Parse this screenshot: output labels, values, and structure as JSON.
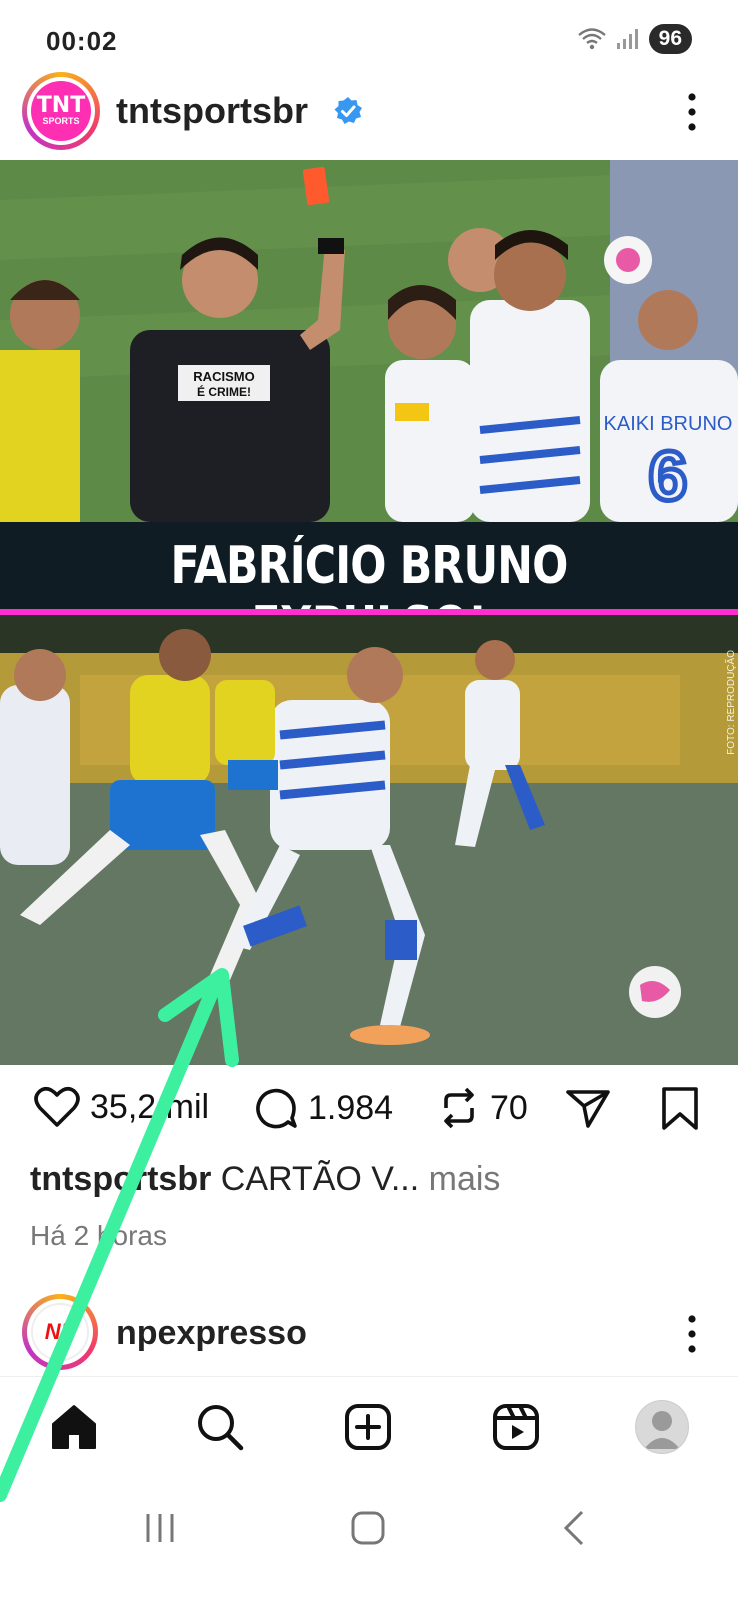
{
  "status_bar": {
    "time": "00:02",
    "battery": "96",
    "icons": [
      "wifi-icon",
      "signal-icon"
    ]
  },
  "post": {
    "username": "tntsportsbr",
    "avatar_line1": "TNT",
    "avatar_line2": "SPORTS",
    "verified_icon": "verified-badge-icon",
    "more_icon": "more-vertical-icon",
    "image": {
      "headline": "FABRÍCIO BRUNO EXPULSO!",
      "credit": "FOTO: REPRODUÇÃO",
      "shirt_text": "RACISMO\nÉ CRIME!"
    },
    "actions": {
      "likes": "35,2 mil",
      "comments": "1.984",
      "reposts": "70"
    },
    "caption_user": "tntsportsbr",
    "caption_text": "CARTÃO V...",
    "caption_more": "mais",
    "time_ago": "Há 2 horas"
  },
  "next_post": {
    "username": "npexpresso",
    "avatar_text": "NP"
  },
  "bottom_nav": {
    "items": [
      "home-icon",
      "search-icon",
      "create-icon",
      "reels-icon",
      "profile-icon"
    ]
  },
  "system_nav": {
    "items": [
      "recents-icon",
      "home-button-icon",
      "back-icon"
    ]
  },
  "colors": {
    "accent_pink": "#ff2fcf",
    "headline_bg": "#0f1c24",
    "verified_blue": "#3897f0",
    "annotation_arrow": "#3cf0a0"
  }
}
